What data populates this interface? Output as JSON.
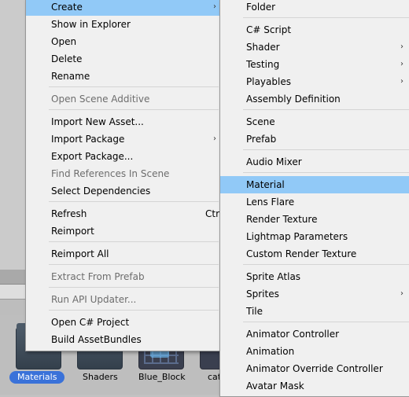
{
  "main_menu": {
    "items": [
      {
        "label": "Create",
        "arrow": "›"
      },
      {
        "label": "Show in Explorer"
      },
      {
        "label": "Open"
      },
      {
        "label": "Delete"
      },
      {
        "label": "Rename"
      },
      {
        "label": "Open Scene Additive"
      },
      {
        "label": "Import New Asset..."
      },
      {
        "label": "Import Package",
        "arrow": "›"
      },
      {
        "label": "Export Package..."
      },
      {
        "label": "Find References In Scene"
      },
      {
        "label": "Select Dependencies"
      },
      {
        "label": "Refresh",
        "shortcut": "Ctrl+R"
      },
      {
        "label": "Reimport"
      },
      {
        "label": "Reimport All"
      },
      {
        "label": "Extract From Prefab"
      },
      {
        "label": "Run API Updater..."
      },
      {
        "label": "Open C# Project"
      },
      {
        "label": "Build AssetBundles"
      }
    ]
  },
  "create_submenu": {
    "items": [
      {
        "label": "Folder"
      },
      {
        "label": "C# Script"
      },
      {
        "label": "Shader",
        "arrow": "›"
      },
      {
        "label": "Testing",
        "arrow": "›"
      },
      {
        "label": "Playables",
        "arrow": "›"
      },
      {
        "label": "Assembly Definition"
      },
      {
        "label": "Scene"
      },
      {
        "label": "Prefab"
      },
      {
        "label": "Audio Mixer"
      },
      {
        "label": "Material"
      },
      {
        "label": "Lens Flare"
      },
      {
        "label": "Render Texture"
      },
      {
        "label": "Lightmap Parameters"
      },
      {
        "label": "Custom Render Texture"
      },
      {
        "label": "Sprite Atlas"
      },
      {
        "label": "Sprites",
        "arrow": "›"
      },
      {
        "label": "Tile"
      },
      {
        "label": "Animator Controller"
      },
      {
        "label": "Animation"
      },
      {
        "label": "Animator Override Controller"
      },
      {
        "label": "Avatar Mask"
      }
    ]
  },
  "assets": [
    {
      "label": "Materials",
      "icon": "folder-icon"
    },
    {
      "label": "Shaders",
      "icon": "folder-icon"
    },
    {
      "label": "Blue_Block",
      "icon": "material-thumbnail"
    },
    {
      "label": "cat",
      "icon": "asset-thumbnail"
    }
  ],
  "colors": {
    "menu_bg": "#f0f0f0",
    "highlight": "#91c9f7",
    "disabled_text": "#6d6d6d",
    "selection_label": "#3a72d9"
  }
}
